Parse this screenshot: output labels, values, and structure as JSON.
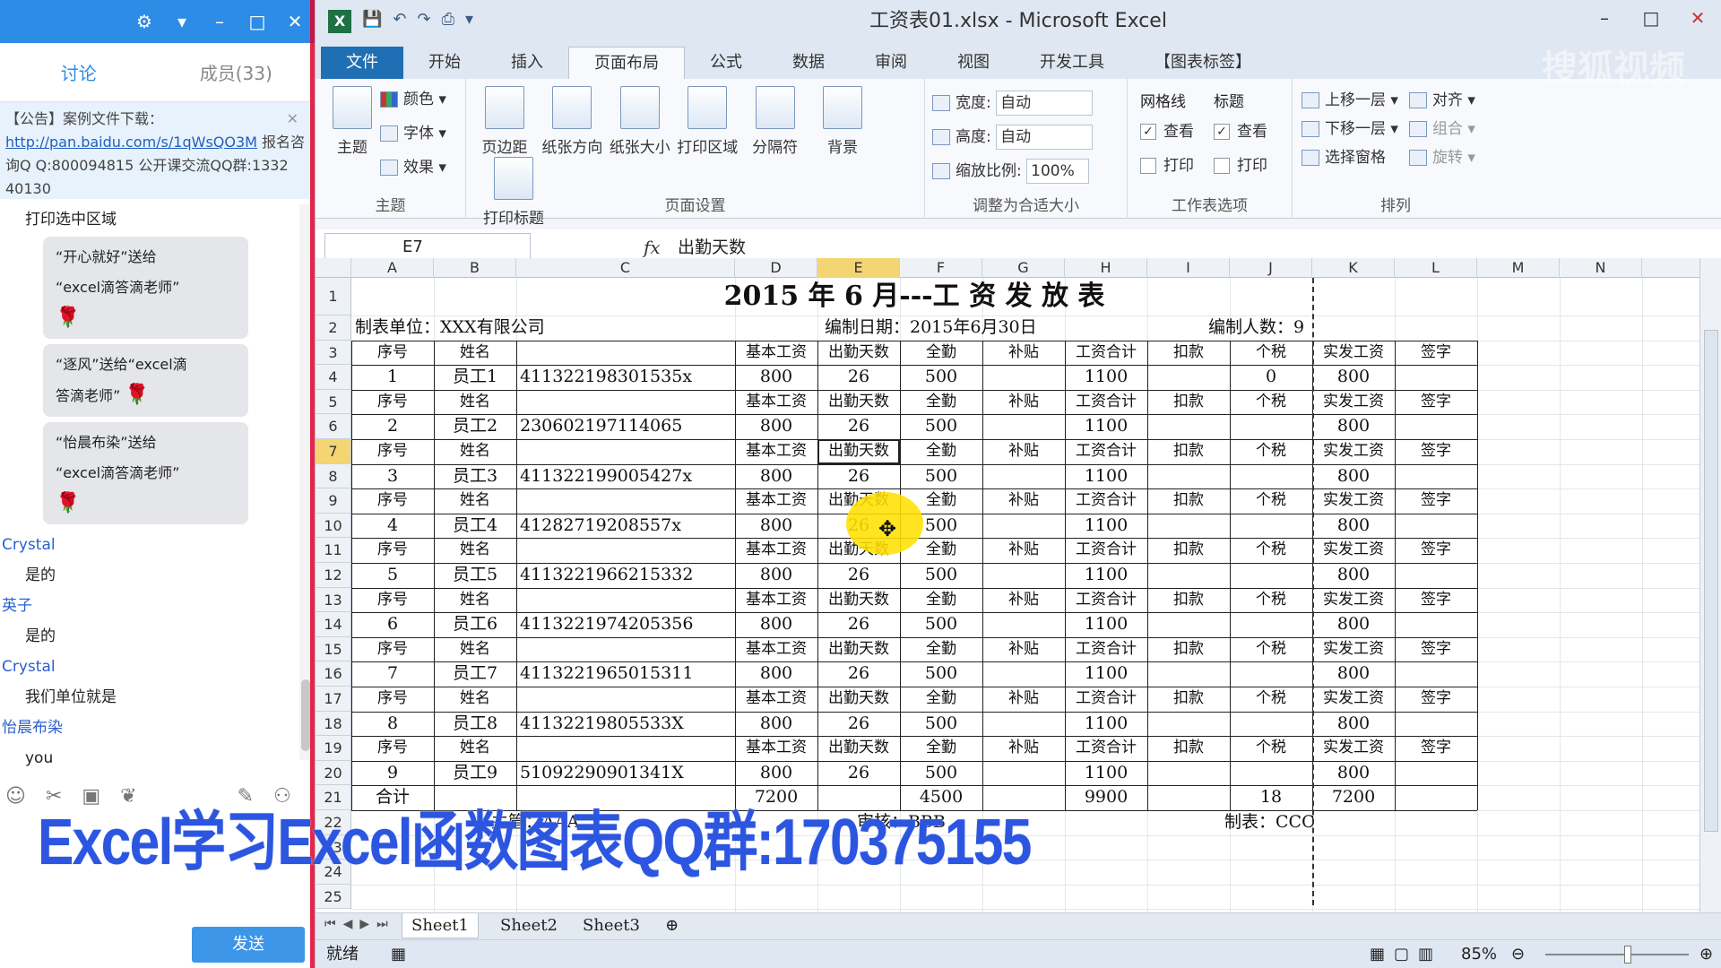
{
  "chat": {
    "tabs": [
      "讨论",
      "成员(33)"
    ],
    "announcement": {
      "prefix": "【公告】案例文件下载：",
      "link": "http://pan.baidu.com/s/1qWsQO3M",
      "rest": " 报名咨询Q Q:800094815  公开课交流QQ群:1332 40130"
    },
    "system": "打印选中区域",
    "gifts": [
      {
        "line1": "“开心就好”送给",
        "line2": "“excel滴答滴老师”"
      },
      {
        "line1": "“逐风”送给“excel滴",
        "line2": "答滴老师”"
      },
      {
        "line1": "“怡晨布染”送给",
        "line2": "“excel滴答滴老师”"
      }
    ],
    "messages": [
      {
        "user": "Crystal",
        "text": "是的"
      },
      {
        "user": "英子",
        "text": "是的"
      },
      {
        "user": "Crystal",
        "text": "我们单位就是"
      },
      {
        "user": "怡晨布染",
        "text": "you"
      }
    ],
    "send": "发送"
  },
  "excel": {
    "title": "工资表01.xlsx - Microsoft Excel",
    "tabs": [
      "文件",
      "开始",
      "插入",
      "页面布局",
      "公式",
      "数据",
      "审阅",
      "视图",
      "开发工具",
      "【图表标签】"
    ],
    "active_tab": "页面布局",
    "ribbon": {
      "theme": {
        "big": "主题",
        "colors": "颜色",
        "fonts": "字体",
        "effects": "效果",
        "group": "主题"
      },
      "page_setup": {
        "buttons": [
          "页边距",
          "纸张方向",
          "纸张大小",
          "打印区域",
          "分隔符",
          "背景",
          "打印标题"
        ],
        "group": "页面设置"
      },
      "scale": {
        "width_label": "宽度:",
        "width_val": "自动",
        "height_label": "高度:",
        "height_val": "自动",
        "zoom_label": "缩放比例:",
        "zoom_val": "100%",
        "group": "调整为合适大小"
      },
      "sheet_options": {
        "gridlines": "网格线",
        "headings": "标题",
        "view": "查看",
        "print": "打印",
        "group": "工作表选项"
      },
      "arrange": {
        "forward": "上移一层",
        "backward": "下移一层",
        "pane": "选择窗格",
        "align": "对齐",
        "groupbtn": "组合",
        "rotate": "旋转",
        "group": "排列"
      }
    },
    "name_box": "E7",
    "fx": "fx",
    "formula": "出勤天数",
    "columns": [
      "A",
      "B",
      "C",
      "D",
      "E",
      "F",
      "G",
      "H",
      "I",
      "J",
      "K",
      "L",
      "M",
      "N"
    ],
    "selected_col": "E",
    "selected_row": "7",
    "sheet": {
      "title": "2015 年 6 月---工  资  发  放  表",
      "unit": "制表单位：XXX有限公司",
      "date": "编制日期：2015年6月30日",
      "count": "编制人数：9",
      "header": [
        "序号",
        "姓名",
        "",
        "基本工资",
        "出勤天数",
        "全勤",
        "补贴",
        "工资合计",
        "扣款",
        "个税",
        "实发工资",
        "签字"
      ],
      "employees": [
        [
          "1",
          "员工1",
          "411322198301535x",
          "800",
          "26",
          "500",
          "",
          "1100",
          "",
          "0",
          "800",
          ""
        ],
        [
          "2",
          "员工2",
          "230602197114065",
          "800",
          "26",
          "500",
          "",
          "1100",
          "",
          "",
          "800",
          ""
        ],
        [
          "3",
          "员工3",
          "411322199005427x",
          "800",
          "26",
          "500",
          "",
          "1100",
          "",
          "",
          "800",
          ""
        ],
        [
          "4",
          "员工4",
          "41282719208557x",
          "800",
          "26",
          "500",
          "",
          "1100",
          "",
          "",
          "800",
          ""
        ],
        [
          "5",
          "员工5",
          "4113221966215332",
          "800",
          "26",
          "500",
          "",
          "1100",
          "",
          "",
          "800",
          ""
        ],
        [
          "6",
          "员工6",
          "4113221974205356",
          "800",
          "26",
          "500",
          "",
          "1100",
          "",
          "",
          "800",
          ""
        ],
        [
          "7",
          "员工7",
          "4113221965015311",
          "800",
          "26",
          "500",
          "",
          "1100",
          "",
          "",
          "800",
          ""
        ],
        [
          "8",
          "员工8",
          "41132219805533X",
          "800",
          "26",
          "500",
          "",
          "1100",
          "",
          "",
          "800",
          ""
        ],
        [
          "9",
          "员工9",
          "51092290901341X",
          "800",
          "26",
          "500",
          "",
          "1100",
          "",
          "",
          "800",
          ""
        ]
      ],
      "total": [
        "合计",
        "",
        "",
        "7200",
        "",
        "4500",
        "",
        "9900",
        "",
        "18",
        "7200",
        ""
      ],
      "footer": {
        "manager": "主管：AAA",
        "audit": "审核：BBB",
        "maker": "制表：CCC"
      }
    },
    "sheet_tabs": [
      "Sheet1",
      "Sheet2",
      "Sheet3"
    ],
    "status": "就绪",
    "zoom": "85%"
  },
  "overlay": {
    "watermark": "Excel学习Excel函数图表QQ群:170375155"
  }
}
